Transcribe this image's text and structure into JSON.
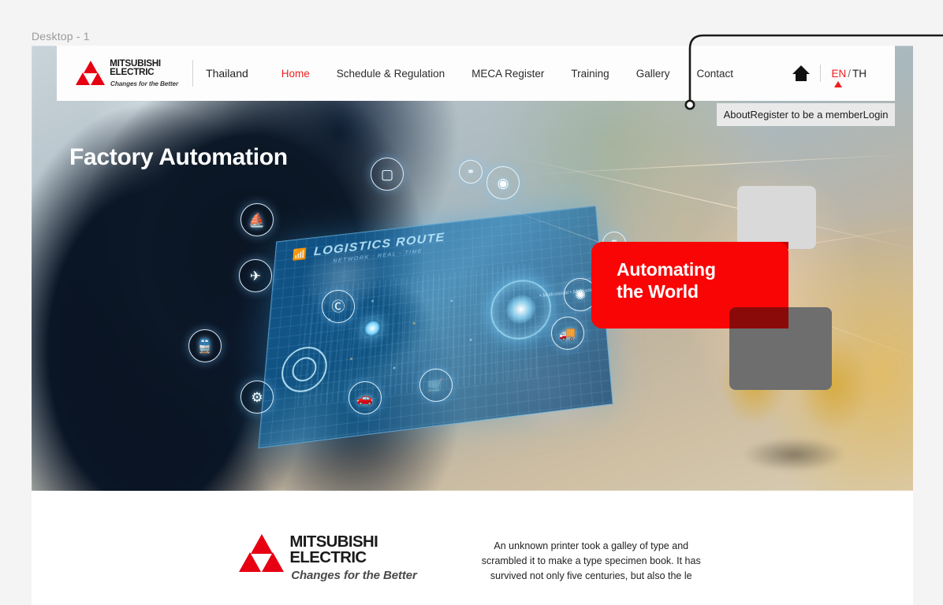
{
  "workspace": {
    "label": "Desktop - 1"
  },
  "site": {
    "brand": {
      "logo_line1": "MITSUBISHI",
      "logo_line2": "ELECTRIC",
      "tagline": "Changes for the Better",
      "country": "Thailand",
      "logo_icon": "mitsubishi-three-diamonds-icon"
    },
    "nav": {
      "items": [
        {
          "label": "Home",
          "active": true
        },
        {
          "label": "Schedule & Regulation",
          "active": false
        },
        {
          "label": "MECA Register",
          "active": false
        },
        {
          "label": "Training",
          "active": false
        },
        {
          "label": "Gallery",
          "active": false
        },
        {
          "label": "Contact",
          "active": false
        }
      ],
      "home_icon": "home-icon",
      "language": {
        "current": "EN",
        "separator": "/",
        "other": "TH",
        "caret_icon": "caret-up-icon"
      }
    },
    "dropdown": {
      "items": [
        "About",
        "Register to be a member",
        "Login"
      ]
    },
    "hero": {
      "title": "Factory Automation",
      "badge_line1": "Automating",
      "badge_line2": "the World",
      "holo_title": "LOGISTICS ROUTE",
      "holo_subtitle": "NETWORK : REAL - TIME",
      "holo_note": "• Multi-modal\n• Multi-user",
      "icons": [
        "package-icon",
        "link-icon",
        "camera-icon",
        "ship-icon",
        "airplane-icon",
        "train-icon",
        "copyright-icon",
        "compass-icon",
        "factory-robot-icon",
        "car-icon",
        "shopping-cart-icon",
        "gear-icon",
        "truck-icon"
      ]
    },
    "footer": {
      "logo_line1": "MITSUBISHI",
      "logo_line2": "ELECTRIC",
      "tagline": "Changes for the Better",
      "blurb": "An unknown printer took a galley of type and scrambled it to make a type specimen book. It has survived not only five centuries, but also the le"
    }
  },
  "colors": {
    "brand_red": "#e60012",
    "accent_red": "#fa0505",
    "nav_active": "#f01f1f",
    "page_bg": "#f4f4f4",
    "shape_light": "#d9d9d9",
    "shape_dark": "#6e6e6e"
  }
}
